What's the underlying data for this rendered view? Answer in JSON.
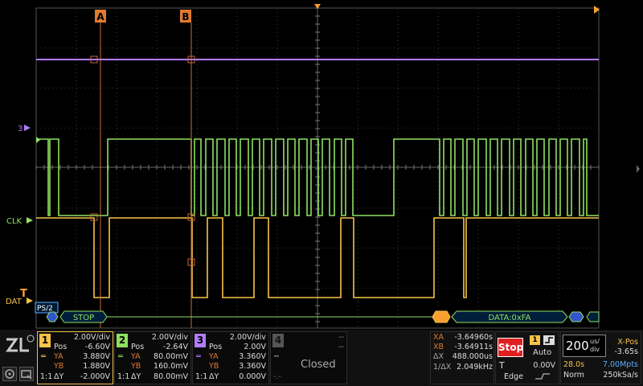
{
  "cursors": {
    "a_label": "A",
    "b_label": "B"
  },
  "waveform_labels": {
    "ch3": "3",
    "clk": "CLK",
    "dat": "DAT",
    "trigger": "T"
  },
  "decode": {
    "bus_name": "PS/2",
    "stop_label": "STOP",
    "data_label": "DATA:0xFA"
  },
  "channels": [
    {
      "num": "1",
      "color": "#f7c24a",
      "div": "2.00V/div",
      "pos_label": "Pos",
      "pos": "-6.60V",
      "ya_label": "YA",
      "ya": "3.880V",
      "yb_label": "YB",
      "yb": "1.880V",
      "dy_label": "ΔY",
      "dy": "-2.000V",
      "coupling": "1:1"
    },
    {
      "num": "2",
      "color": "#8fe060",
      "div": "2.00V/div",
      "pos_label": "Pos",
      "pos": "-2.64V",
      "ya_label": "YA",
      "ya": "80.00mV",
      "yb_label": "YB",
      "yb": "160.0mV",
      "dy_label": "ΔY",
      "dy": "80.00mV",
      "coupling": "1:1"
    },
    {
      "num": "3",
      "color": "#b37cff",
      "div": "2.00V/div",
      "pos_label": "Pos",
      "pos": "2.00V",
      "ya_label": "YA",
      "ya": "3.360V",
      "yb_label": "YB",
      "yb": "3.360V",
      "dy_label": "ΔY",
      "dy": "0.000V",
      "coupling": "1:1"
    },
    {
      "num": "4",
      "color": "#555555",
      "div": "--",
      "pos": "--",
      "ya": "--",
      "yb": "--",
      "dy": "--",
      "status": "Closed"
    }
  ],
  "measure": {
    "xa_label": "XA",
    "xa": "-3.64960s",
    "xb_label": "XB",
    "xb": "-3.64911s",
    "dx_label": "ΔX",
    "dx": "488.000us",
    "inv_dx_label": "1/ΔX",
    "inv_dx": "2.049kHz"
  },
  "run": {
    "state": "Stop",
    "trigger_source": "1",
    "mode": "Auto",
    "trigger_label": "T",
    "trigger_level": "0.00V",
    "trigger_type": "Edge"
  },
  "timebase": {
    "scale": "200",
    "unit_top": "us/",
    "unit_bottom": "div",
    "xpos_label": "X-Pos",
    "xpos": "-3.65s",
    "memory_time": "28.0s",
    "memory_depth": "7.00Mpts",
    "acq_mode": "Norm",
    "sample_rate": "250kSa/s"
  },
  "colors": {
    "ch1": "#f7c24a",
    "ch2": "#8fe060",
    "ch3": "#b37cff",
    "cursor": "#c86a3a",
    "stop": "#e02020",
    "decode": "#8fe060"
  }
}
